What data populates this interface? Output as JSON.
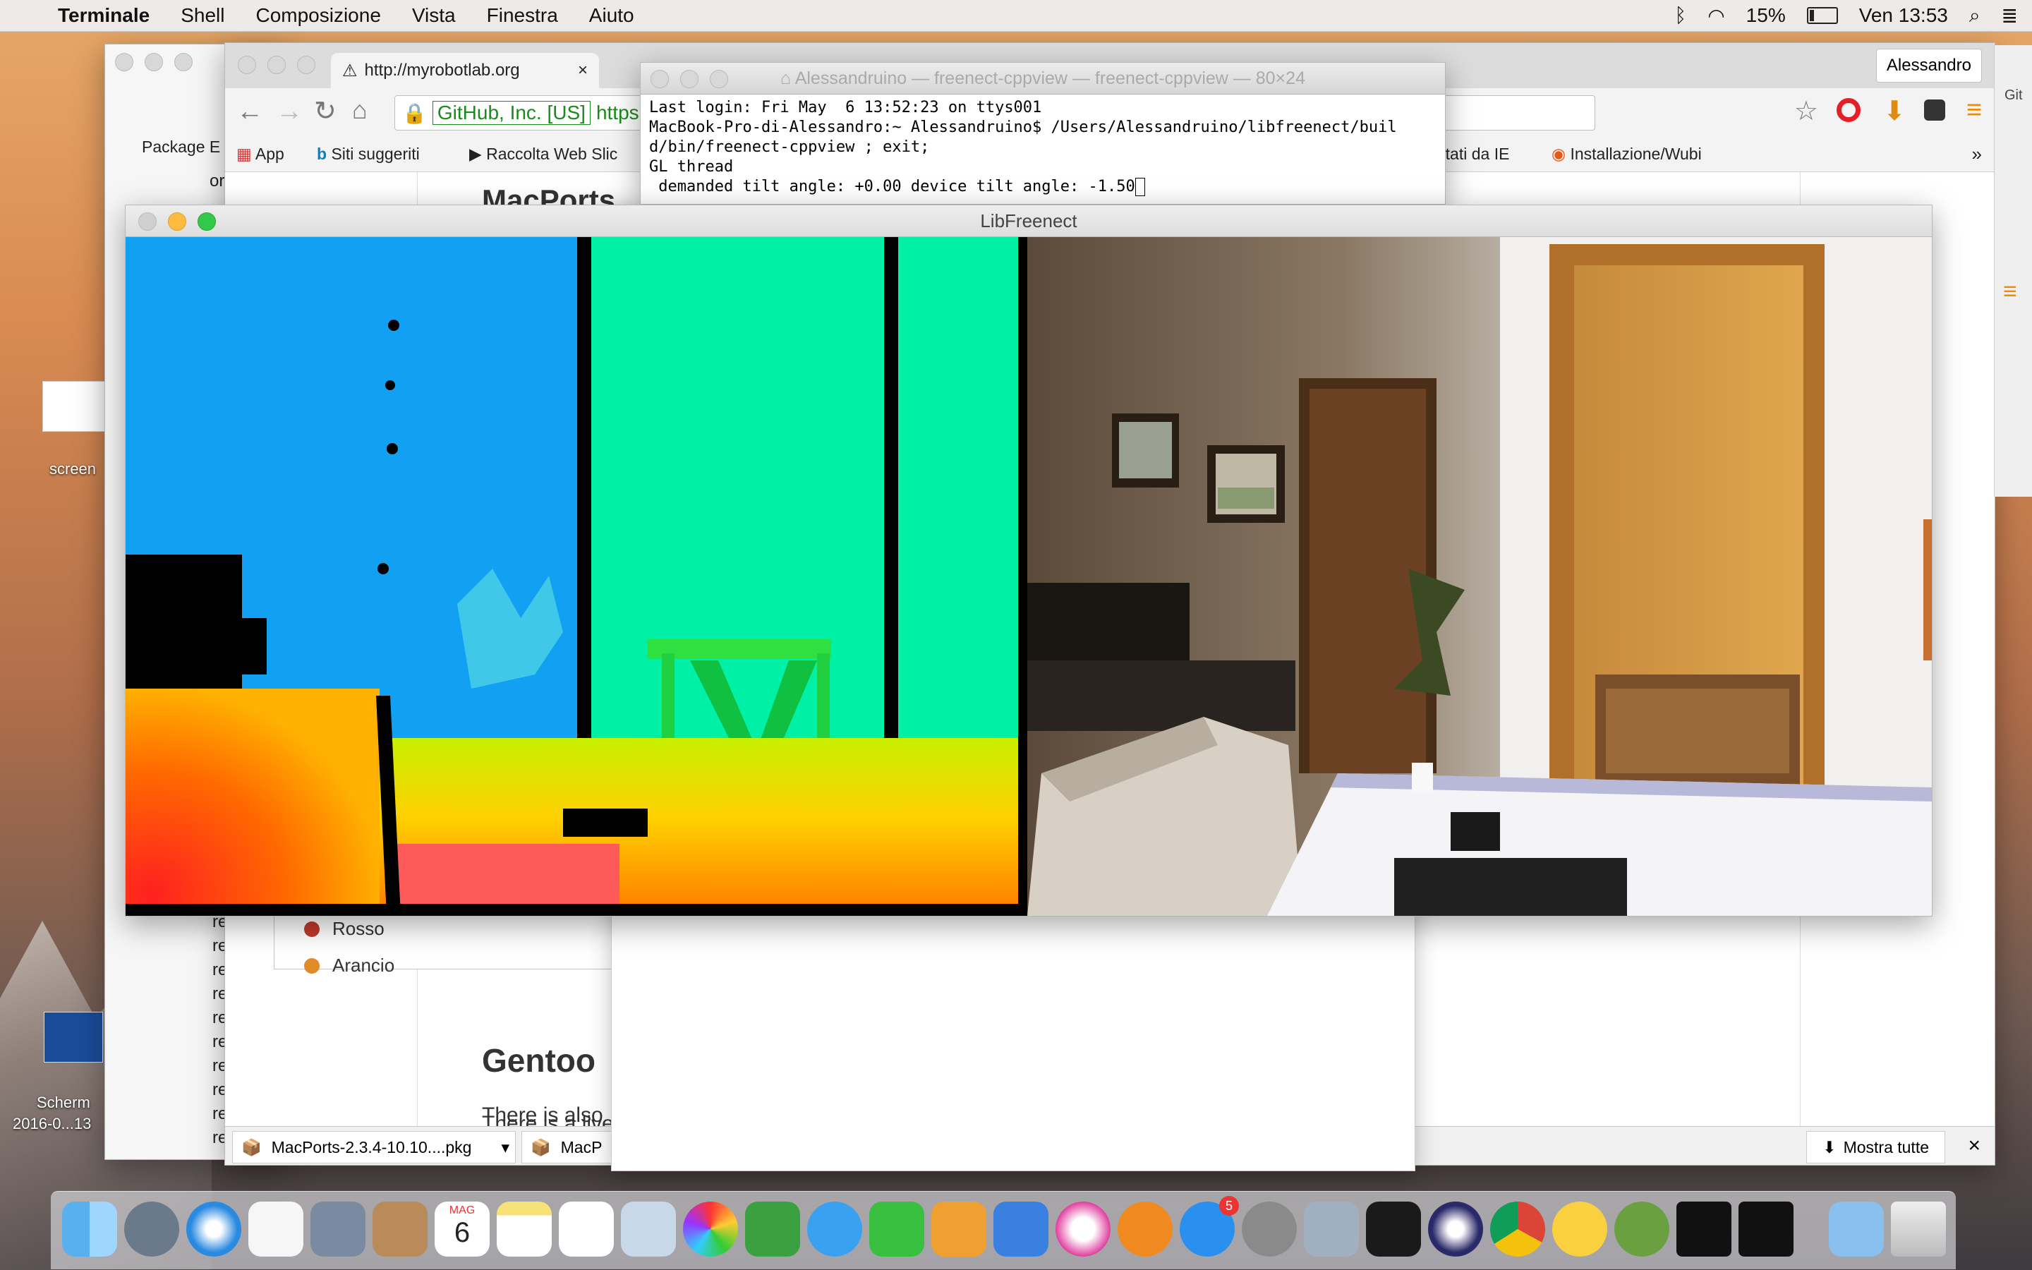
{
  "menubar": {
    "app": "Terminale",
    "items": [
      "Shell",
      "Composizione",
      "Vista",
      "Finestra",
      "Aiuto"
    ],
    "battery": "15%",
    "clock": "Ven 13:53"
  },
  "desktop": {
    "label1": "screen",
    "label2": "Scherm",
    "label3": "2016-0...13"
  },
  "chrome": {
    "tab1": "http://myrobotlab.org",
    "tab_close": "×",
    "profile": "Alessandro",
    "secure_label": "GitHub, Inc. [US]",
    "url_fragment": "https",
    "bookmarks": {
      "apps": "App",
      "siti": "Siti suggeriti",
      "raccolta": "Raccolta Web Slic",
      "ie": "rtati da IE",
      "install": "Installazione/Wubi",
      "more": "»"
    },
    "content": {
      "heading1": "MacPorts",
      "paragraph1": "There is also",
      "heading2": "Gentoo",
      "paragraph2": "There is a live"
    },
    "downloads": {
      "file1": "MacPorts-2.3.4-10.10....pkg",
      "file2": "MacP",
      "show_all": "Mostra tutte",
      "close": "×"
    }
  },
  "backwin": {
    "label": "Package E",
    "tree_item": "or",
    "tree_re": "re"
  },
  "terminal": {
    "title": "Alessandruino — freenect-cppview — freenect-cppview — 80×24",
    "lines": [
      "Last login: Fri May  6 13:52:23 on ttys001",
      "MacBook-Pro-di-Alessandro:~ Alessandruino$ /Users/Alessandruino/libfreenect/buil",
      "d/bin/freenect-cppview ; exit;",
      "GL thread",
      " demanded tilt angle: +0.00 device tilt angle: -1.50"
    ]
  },
  "libfreenect": {
    "title": "LibFreenect"
  },
  "calwin": {
    "item1": "Rosso",
    "item2": "Arancio"
  },
  "dock": {
    "calendar_month": "MAG",
    "calendar_day": "6",
    "badge": "5"
  },
  "colors": {
    "menubar": "#ececec",
    "depth_blue": "#10a0f0",
    "depth_green": "#00f0a0",
    "close_red": "#fc605c",
    "min_yellow": "#fdbc40",
    "zoom_green": "#34c84a"
  }
}
